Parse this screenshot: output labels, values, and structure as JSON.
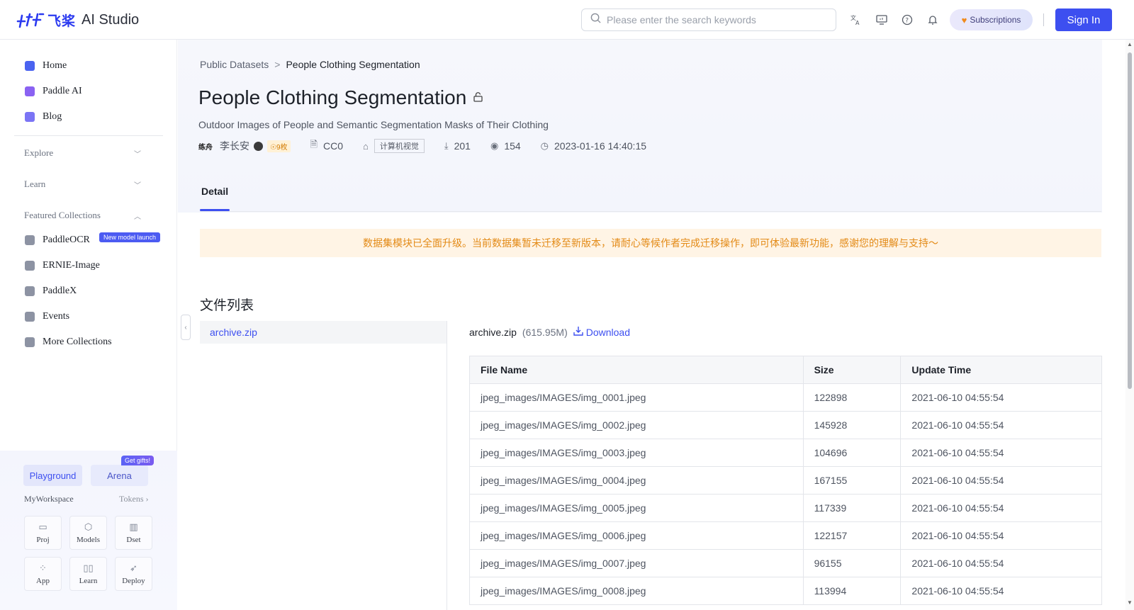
{
  "header": {
    "logo_cn": "飞桨",
    "logo_text": "AI Studio",
    "search_placeholder": "Please enter the search keywords",
    "subscriptions": "Subscriptions",
    "sign_in": "Sign In"
  },
  "sidebar": {
    "top_items": [
      {
        "label": "Home",
        "color": "#4a63f0"
      },
      {
        "label": "Paddle AI",
        "color": "#8a62f2"
      },
      {
        "label": "Blog",
        "color": "#7b74f5"
      }
    ],
    "sections": {
      "explore": "Explore",
      "learn": "Learn",
      "featured": "Featured Collections"
    },
    "collections": [
      {
        "label": "PaddleOCR",
        "color": "#8d93a3"
      },
      {
        "label": "ERNIE-Image",
        "color": "#8d93a3"
      },
      {
        "label": "PaddleX",
        "color": "#8d93a3"
      },
      {
        "label": "Events",
        "color": "#8d93a3"
      },
      {
        "label": "More Collections",
        "color": "#8d93a3"
      }
    ],
    "badge_new": "New model launch",
    "workspace": {
      "playground": "Playground",
      "arena": "Arena",
      "gifts": "Get gifts!",
      "label": "MyWorkspace",
      "tokens": "Tokens",
      "cards": [
        "Proj",
        "Models",
        "Dset",
        "App",
        "Learn",
        "Deploy"
      ]
    }
  },
  "breadcrumb": {
    "parent": "Public Datasets",
    "separator": ">",
    "current": "People Clothing Segmentation"
  },
  "dataset": {
    "title": "People Clothing Segmentation",
    "subtitle": "Outdoor Images of People and Semantic Segmentation Masks of Their Clothing",
    "author_seal": "练舟",
    "author": "李长安",
    "level": "9枚",
    "license": "CC0",
    "tag": "计算机视觉",
    "downloads": "201",
    "views": "154",
    "updated": "2023-01-16 14:40:15"
  },
  "tabs": {
    "detail": "Detail"
  },
  "notice": "数据集模块已全面升级。当前数据集暂未迁移至新版本，请耐心等候作者完成迁移操作，即可体验最新功能，感谢您的理解与支持～",
  "files": {
    "heading": "文件列表",
    "list": [
      "archive.zip"
    ],
    "selected": {
      "name": "archive.zip",
      "size": "(615.95M)",
      "download": "Download"
    },
    "columns": [
      "File Name",
      "Size",
      "Update Time"
    ],
    "rows": [
      [
        "jpeg_images/IMAGES/img_0001.jpeg",
        "122898",
        "2021-06-10 04:55:54"
      ],
      [
        "jpeg_images/IMAGES/img_0002.jpeg",
        "145928",
        "2021-06-10 04:55:54"
      ],
      [
        "jpeg_images/IMAGES/img_0003.jpeg",
        "104696",
        "2021-06-10 04:55:54"
      ],
      [
        "jpeg_images/IMAGES/img_0004.jpeg",
        "167155",
        "2021-06-10 04:55:54"
      ],
      [
        "jpeg_images/IMAGES/img_0005.jpeg",
        "117339",
        "2021-06-10 04:55:54"
      ],
      [
        "jpeg_images/IMAGES/img_0006.jpeg",
        "122157",
        "2021-06-10 04:55:54"
      ],
      [
        "jpeg_images/IMAGES/img_0007.jpeg",
        "96155",
        "2021-06-10 04:55:54"
      ],
      [
        "jpeg_images/IMAGES/img_0008.jpeg",
        "113994",
        "2021-06-10 04:55:54"
      ]
    ]
  }
}
